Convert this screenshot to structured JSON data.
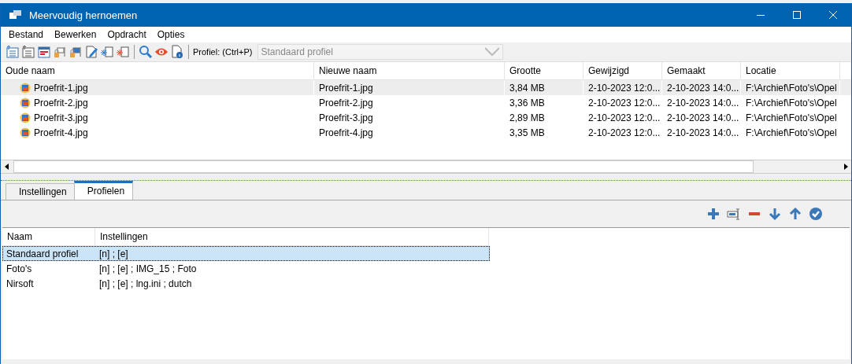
{
  "window": {
    "title": "Meervoudig hernoemen"
  },
  "menu": [
    "Bestand",
    "Bewerken",
    "Opdracht",
    "Opties"
  ],
  "toolbar": {
    "profile_label": "Profiel: (Ctrl+P)",
    "profile_value": "Standaard profiel"
  },
  "files": {
    "columns": [
      "Oude naam",
      "Nieuwe naam",
      "Grootte",
      "Gewijzigd",
      "Gemaakt",
      "Locatie"
    ],
    "rows": [
      {
        "selected": true,
        "cells": [
          "Proefrit-1.jpg",
          "Proefrit-1.jpg",
          "3,84 MB",
          "2-10-2023 12:0...",
          "2-10-2023 14:0...",
          "F:\\Archief\\Foto's\\Opel"
        ]
      },
      {
        "selected": false,
        "cells": [
          "Proefrit-2.jpg",
          "Proefrit-2.jpg",
          "3,36 MB",
          "2-10-2023 12:0...",
          "2-10-2023 14:0...",
          "F:\\Archief\\Foto's\\Opel"
        ]
      },
      {
        "selected": false,
        "cells": [
          "Proefrit-3.jpg",
          "Proefrit-3.jpg",
          "2,89 MB",
          "2-10-2023 12:0...",
          "2-10-2023 14:0...",
          "F:\\Archief\\Foto's\\Opel"
        ]
      },
      {
        "selected": false,
        "cells": [
          "Proefrit-4.jpg",
          "Proefrit-4.jpg",
          "3,35 MB",
          "2-10-2023 12:0...",
          "2-10-2023 14:0...",
          "F:\\Archief\\Foto's\\Opel"
        ]
      }
    ]
  },
  "tabs": [
    {
      "label": "Instellingen",
      "selected": false
    },
    {
      "label": "Profielen",
      "selected": true
    }
  ],
  "profiles": {
    "columns": [
      "Naam",
      "Instellingen"
    ],
    "rows": [
      {
        "selected": true,
        "cells": [
          "Standaard profiel",
          "[n] ; [e]"
        ]
      },
      {
        "selected": false,
        "cells": [
          "Foto's",
          "[n] ; [e] ; IMG_15 ; Foto"
        ]
      },
      {
        "selected": false,
        "cells": [
          "Nirsoft",
          "[n] ; [e] ; lng.ini ; dutch"
        ]
      }
    ]
  }
}
